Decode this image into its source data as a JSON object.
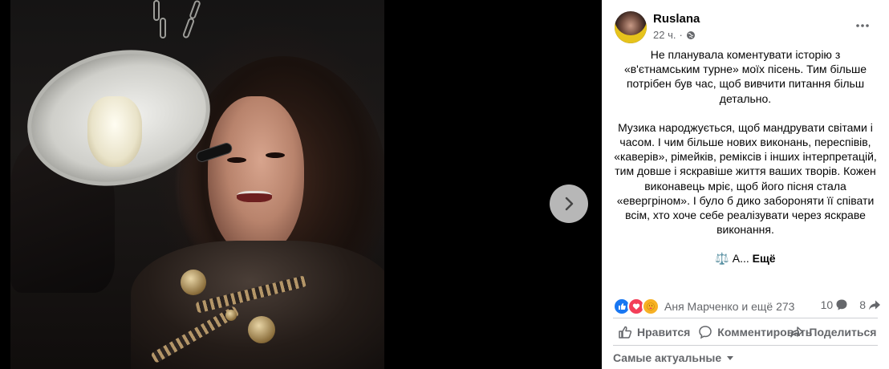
{
  "post": {
    "author": "Ruslana",
    "time": "22 ч.",
    "privacy_icon": "globe-icon",
    "paragraphs": [
      "Не планувала коментувати історію з «в'єтнамським турне» моїх пісень. Тим більше потрібен був час, щоб вивчити питання більш детально.",
      "Музика народжується, щоб мандрувати світами і часом. І чим більше нових виконань, переспівів, «каверів», рімейків, реміксів і інших інтерпретацій, тим довше і яскравіше життя ваших творів. Кожен виконавець мріє, щоб його пісня стала «евергріном». І було б дико забороняти її співати всім, хто хоче себе реалізувати через яскраве виконання."
    ],
    "truncated_line": "⚖️ А...",
    "see_more": "Ещё"
  },
  "reactions": {
    "icons": [
      "like-icon",
      "love-icon",
      "care-icon"
    ],
    "summary": "Аня Марченко и ещё 273",
    "comments_count": "10",
    "shares_count": "8"
  },
  "actions": {
    "like": "Нравится",
    "comment": "Комментировать",
    "share": "Поделиться"
  },
  "comments_sort": "Самые актуальные",
  "colors": {
    "like_blue": "#1877f2",
    "love_red": "#f33e58",
    "care_yellow": "#f7b125",
    "secondary_text": "#65676b",
    "divider": "#ced0d4"
  }
}
